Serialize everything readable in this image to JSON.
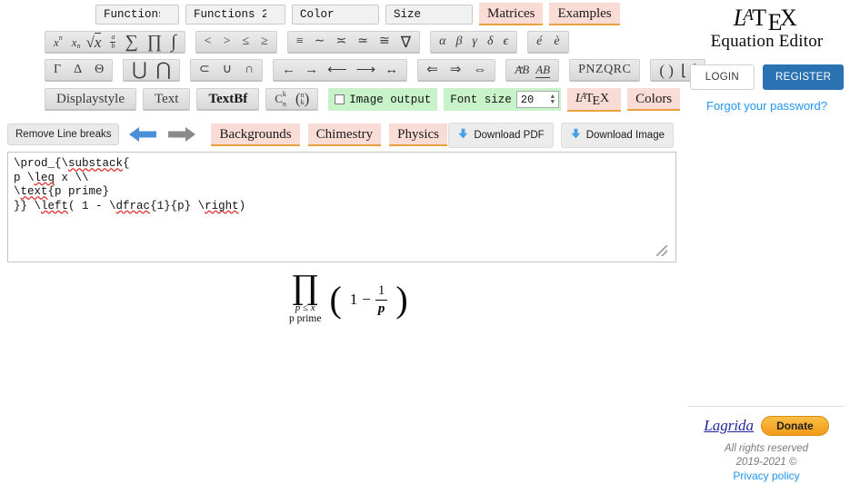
{
  "brand": {
    "latex_l": "L",
    "latex_a": "A",
    "latex_t": "T",
    "latex_e": "E",
    "latex_x": "X",
    "subtitle": "Equation Editor"
  },
  "auth": {
    "login_label": "LOGIN",
    "register_label": "REGISTER",
    "forgot_label": "Forgot your password?",
    "register_color": "#2b72b3",
    "link_color": "#2196f3"
  },
  "toolbar": {
    "dropdowns": [
      {
        "label": "Functions",
        "name": "functions"
      },
      {
        "label": "Functions 2",
        "name": "functions-2"
      },
      {
        "label": "Color",
        "name": "color"
      },
      {
        "label": "Size",
        "name": "size"
      }
    ],
    "pink_buttons_row1": [
      {
        "label": "Matrices",
        "name": "matrices"
      },
      {
        "label": "Examples",
        "name": "examples"
      }
    ],
    "pink_color": "#fadcd6",
    "pink_underline": "#e8a13c",
    "groups_row2": [
      {
        "name": "math-basics",
        "symbols": [
          "x^n",
          "x_n",
          "√x",
          "a/b",
          "∑",
          "∏",
          "∫"
        ]
      },
      {
        "name": "comparisons",
        "symbols": [
          "<",
          ">",
          "≤",
          "≥"
        ]
      },
      {
        "name": "equivalences",
        "symbols": [
          "≡",
          "∼",
          "≍",
          "≃",
          "≅",
          "∇"
        ]
      },
      {
        "name": "greek-lowercase",
        "symbols": [
          "α",
          "β",
          "γ",
          "δ",
          "ϵ"
        ]
      },
      {
        "name": "accents",
        "symbols": [
          "é",
          "è"
        ]
      }
    ],
    "groups_row3": [
      {
        "name": "greek-uppercase",
        "symbols": [
          "Γ",
          "Δ",
          "Θ"
        ]
      },
      {
        "name": "big-operators",
        "symbols": [
          "⋃",
          "⋂"
        ]
      },
      {
        "name": "set-operators",
        "symbols": [
          "⊂",
          "∪",
          "∩"
        ]
      },
      {
        "name": "arrows",
        "symbols": [
          "←",
          "→",
          "⟵",
          "⟶",
          "↔"
        ]
      },
      {
        "name": "double-arrows",
        "symbols": [
          "⇐",
          "⇒",
          "⇔"
        ]
      },
      {
        "name": "vectors",
        "symbols": [
          "AB",
          "AB"
        ]
      },
      {
        "name": "number-sets",
        "symbols": [
          "PNZQRC"
        ]
      },
      {
        "name": "delimiters",
        "symbols": [
          "(",
          ")",
          "⌊",
          "⌋"
        ]
      }
    ],
    "text_buttons": [
      {
        "label": "Displaystyle",
        "name": "displaystyle"
      },
      {
        "label": "Text",
        "name": "text"
      },
      {
        "label": "TextBf",
        "name": "textbf"
      }
    ],
    "binom_button": {
      "name": "binomial",
      "c": "C",
      "sup": "k",
      "sub": "n",
      "top": "n",
      "bottom": "k"
    },
    "image_output": {
      "label": "Image output",
      "checked": false
    },
    "font_size": {
      "label": "Font size",
      "value": "20"
    },
    "pink_buttons_row4": [
      {
        "label": "LaTeX",
        "name": "latex"
      },
      {
        "label": "Colors",
        "name": "colors"
      }
    ],
    "green_color": "#c8f2c8"
  },
  "actions": {
    "remove_line_breaks": "Remove Line breaks",
    "undo_icon": "left-arrow-icon",
    "redo_icon": "right-arrow-icon",
    "undo_color": "#4a90d9",
    "redo_color": "#7a7a7a",
    "category_buttons": [
      {
        "label": "Backgrounds",
        "name": "backgrounds"
      },
      {
        "label": "Chimestry",
        "name": "chimestry"
      },
      {
        "label": "Physics",
        "name": "physics"
      }
    ],
    "download_pdf": "Download PDF",
    "download_image": "Download Image",
    "download_icon_color": "#4a9fe0"
  },
  "source": {
    "line1_a": "\\prod_{\\",
    "line1_b": "substack",
    "line1_c": "{",
    "line2_a": "p \\",
    "line2_b": "leq",
    "line2_c": " x \\\\",
    "line3_a": "\\",
    "line3_b": "text",
    "line3_c": "{p prime}",
    "line4_a": "}} \\",
    "line4_b": "left",
    "line4_c": "( 1 - \\",
    "line4_d": "dfrac",
    "line4_e": "{1}{p} \\",
    "line4_f": "right",
    "line4_g": ")"
  },
  "equation": {
    "product_symbol": "∏",
    "lower_limit": "p ≤ x",
    "lower_limit2": "p prime",
    "left_paren": "(",
    "one": "1",
    "minus": "−",
    "frac_num": "1",
    "frac_den": "p",
    "right_paren": ")"
  },
  "footer": {
    "site_name": "Lagrida",
    "donate_label": "Donate",
    "rights": "All rights reserved",
    "years": "2019-2021 ©",
    "privacy": "Privacy policy"
  }
}
